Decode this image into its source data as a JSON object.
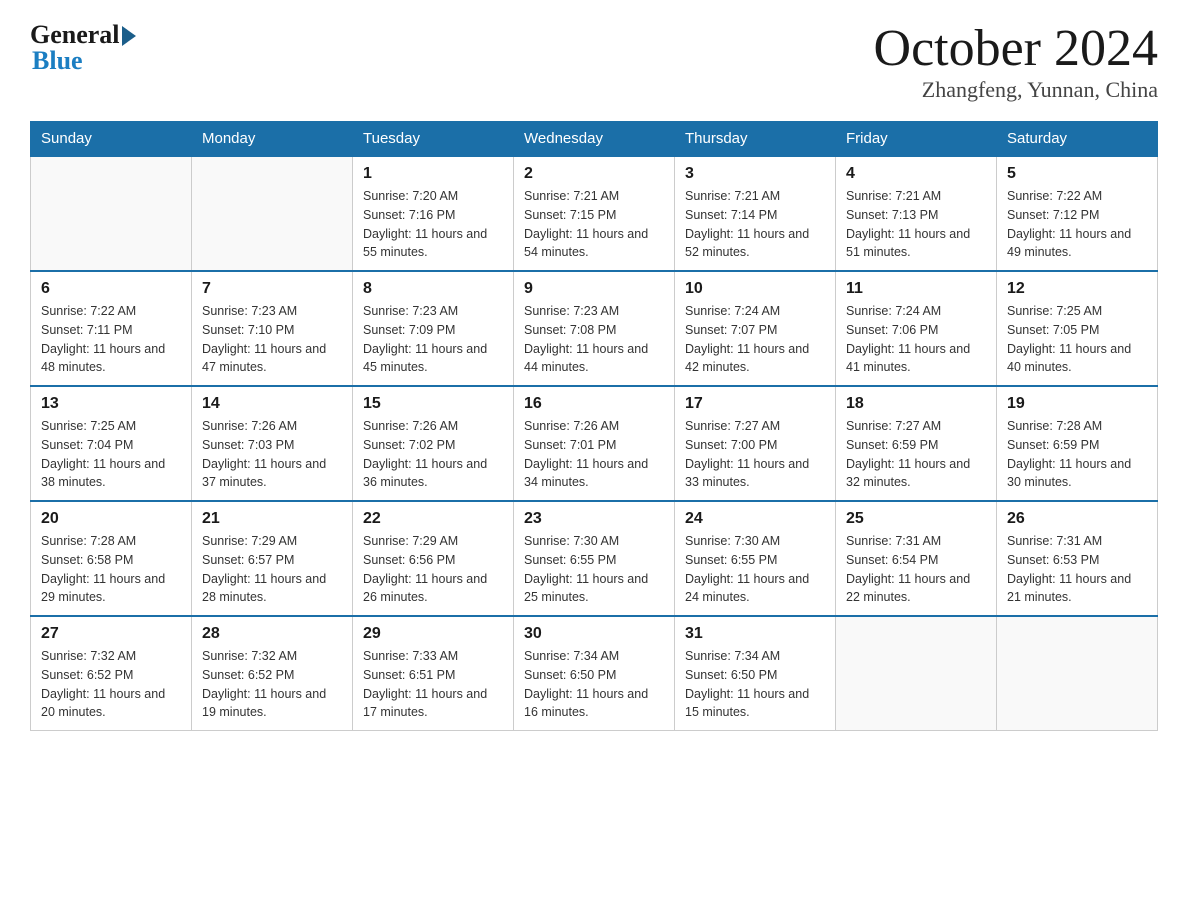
{
  "header": {
    "logo_general": "General",
    "logo_blue": "Blue",
    "month_title": "October 2024",
    "location": "Zhangfeng, Yunnan, China"
  },
  "weekdays": [
    "Sunday",
    "Monday",
    "Tuesday",
    "Wednesday",
    "Thursday",
    "Friday",
    "Saturday"
  ],
  "weeks": [
    [
      {
        "day": "",
        "sunrise": "",
        "sunset": "",
        "daylight": ""
      },
      {
        "day": "",
        "sunrise": "",
        "sunset": "",
        "daylight": ""
      },
      {
        "day": "1",
        "sunrise": "Sunrise: 7:20 AM",
        "sunset": "Sunset: 7:16 PM",
        "daylight": "Daylight: 11 hours and 55 minutes."
      },
      {
        "day": "2",
        "sunrise": "Sunrise: 7:21 AM",
        "sunset": "Sunset: 7:15 PM",
        "daylight": "Daylight: 11 hours and 54 minutes."
      },
      {
        "day": "3",
        "sunrise": "Sunrise: 7:21 AM",
        "sunset": "Sunset: 7:14 PM",
        "daylight": "Daylight: 11 hours and 52 minutes."
      },
      {
        "day": "4",
        "sunrise": "Sunrise: 7:21 AM",
        "sunset": "Sunset: 7:13 PM",
        "daylight": "Daylight: 11 hours and 51 minutes."
      },
      {
        "day": "5",
        "sunrise": "Sunrise: 7:22 AM",
        "sunset": "Sunset: 7:12 PM",
        "daylight": "Daylight: 11 hours and 49 minutes."
      }
    ],
    [
      {
        "day": "6",
        "sunrise": "Sunrise: 7:22 AM",
        "sunset": "Sunset: 7:11 PM",
        "daylight": "Daylight: 11 hours and 48 minutes."
      },
      {
        "day": "7",
        "sunrise": "Sunrise: 7:23 AM",
        "sunset": "Sunset: 7:10 PM",
        "daylight": "Daylight: 11 hours and 47 minutes."
      },
      {
        "day": "8",
        "sunrise": "Sunrise: 7:23 AM",
        "sunset": "Sunset: 7:09 PM",
        "daylight": "Daylight: 11 hours and 45 minutes."
      },
      {
        "day": "9",
        "sunrise": "Sunrise: 7:23 AM",
        "sunset": "Sunset: 7:08 PM",
        "daylight": "Daylight: 11 hours and 44 minutes."
      },
      {
        "day": "10",
        "sunrise": "Sunrise: 7:24 AM",
        "sunset": "Sunset: 7:07 PM",
        "daylight": "Daylight: 11 hours and 42 minutes."
      },
      {
        "day": "11",
        "sunrise": "Sunrise: 7:24 AM",
        "sunset": "Sunset: 7:06 PM",
        "daylight": "Daylight: 11 hours and 41 minutes."
      },
      {
        "day": "12",
        "sunrise": "Sunrise: 7:25 AM",
        "sunset": "Sunset: 7:05 PM",
        "daylight": "Daylight: 11 hours and 40 minutes."
      }
    ],
    [
      {
        "day": "13",
        "sunrise": "Sunrise: 7:25 AM",
        "sunset": "Sunset: 7:04 PM",
        "daylight": "Daylight: 11 hours and 38 minutes."
      },
      {
        "day": "14",
        "sunrise": "Sunrise: 7:26 AM",
        "sunset": "Sunset: 7:03 PM",
        "daylight": "Daylight: 11 hours and 37 minutes."
      },
      {
        "day": "15",
        "sunrise": "Sunrise: 7:26 AM",
        "sunset": "Sunset: 7:02 PM",
        "daylight": "Daylight: 11 hours and 36 minutes."
      },
      {
        "day": "16",
        "sunrise": "Sunrise: 7:26 AM",
        "sunset": "Sunset: 7:01 PM",
        "daylight": "Daylight: 11 hours and 34 minutes."
      },
      {
        "day": "17",
        "sunrise": "Sunrise: 7:27 AM",
        "sunset": "Sunset: 7:00 PM",
        "daylight": "Daylight: 11 hours and 33 minutes."
      },
      {
        "day": "18",
        "sunrise": "Sunrise: 7:27 AM",
        "sunset": "Sunset: 6:59 PM",
        "daylight": "Daylight: 11 hours and 32 minutes."
      },
      {
        "day": "19",
        "sunrise": "Sunrise: 7:28 AM",
        "sunset": "Sunset: 6:59 PM",
        "daylight": "Daylight: 11 hours and 30 minutes."
      }
    ],
    [
      {
        "day": "20",
        "sunrise": "Sunrise: 7:28 AM",
        "sunset": "Sunset: 6:58 PM",
        "daylight": "Daylight: 11 hours and 29 minutes."
      },
      {
        "day": "21",
        "sunrise": "Sunrise: 7:29 AM",
        "sunset": "Sunset: 6:57 PM",
        "daylight": "Daylight: 11 hours and 28 minutes."
      },
      {
        "day": "22",
        "sunrise": "Sunrise: 7:29 AM",
        "sunset": "Sunset: 6:56 PM",
        "daylight": "Daylight: 11 hours and 26 minutes."
      },
      {
        "day": "23",
        "sunrise": "Sunrise: 7:30 AM",
        "sunset": "Sunset: 6:55 PM",
        "daylight": "Daylight: 11 hours and 25 minutes."
      },
      {
        "day": "24",
        "sunrise": "Sunrise: 7:30 AM",
        "sunset": "Sunset: 6:55 PM",
        "daylight": "Daylight: 11 hours and 24 minutes."
      },
      {
        "day": "25",
        "sunrise": "Sunrise: 7:31 AM",
        "sunset": "Sunset: 6:54 PM",
        "daylight": "Daylight: 11 hours and 22 minutes."
      },
      {
        "day": "26",
        "sunrise": "Sunrise: 7:31 AM",
        "sunset": "Sunset: 6:53 PM",
        "daylight": "Daylight: 11 hours and 21 minutes."
      }
    ],
    [
      {
        "day": "27",
        "sunrise": "Sunrise: 7:32 AM",
        "sunset": "Sunset: 6:52 PM",
        "daylight": "Daylight: 11 hours and 20 minutes."
      },
      {
        "day": "28",
        "sunrise": "Sunrise: 7:32 AM",
        "sunset": "Sunset: 6:52 PM",
        "daylight": "Daylight: 11 hours and 19 minutes."
      },
      {
        "day": "29",
        "sunrise": "Sunrise: 7:33 AM",
        "sunset": "Sunset: 6:51 PM",
        "daylight": "Daylight: 11 hours and 17 minutes."
      },
      {
        "day": "30",
        "sunrise": "Sunrise: 7:34 AM",
        "sunset": "Sunset: 6:50 PM",
        "daylight": "Daylight: 11 hours and 16 minutes."
      },
      {
        "day": "31",
        "sunrise": "Sunrise: 7:34 AM",
        "sunset": "Sunset: 6:50 PM",
        "daylight": "Daylight: 11 hours and 15 minutes."
      },
      {
        "day": "",
        "sunrise": "",
        "sunset": "",
        "daylight": ""
      },
      {
        "day": "",
        "sunrise": "",
        "sunset": "",
        "daylight": ""
      }
    ]
  ]
}
